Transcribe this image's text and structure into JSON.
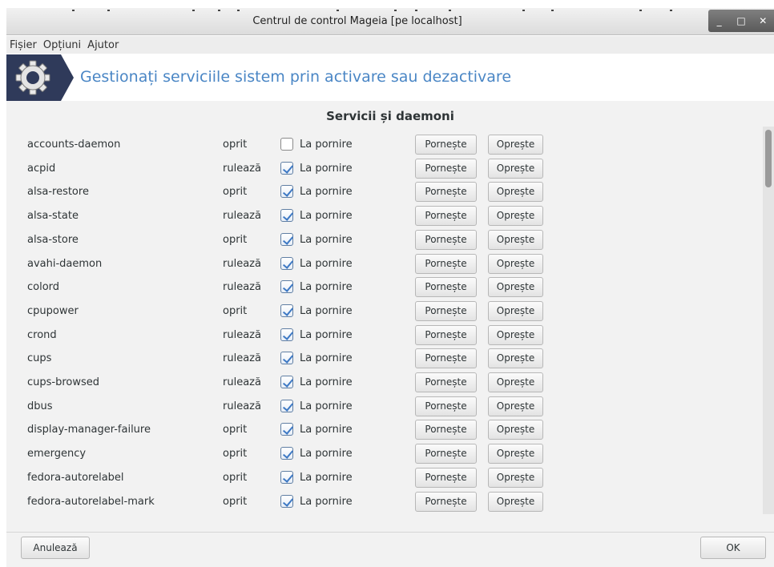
{
  "window": {
    "title": "Centrul de control Mageia  [pe localhost]",
    "controls": {
      "minimize": "_",
      "maximize": "□",
      "close": "✕"
    }
  },
  "menu": [
    "Fișier",
    "Opțiuni",
    "Ajutor"
  ],
  "banner": {
    "title": "Gestionați serviciile sistem prin activare sau dezactivare",
    "icon": "gear-icon"
  },
  "section_title": "Servicii și daemoni",
  "services": [
    {
      "name": "accounts-daemon",
      "state": "oprit",
      "on_boot": false,
      "boot_label": "La pornire",
      "start": "Pornește",
      "stop": "Oprește"
    },
    {
      "name": "acpid",
      "state": "rulează",
      "on_boot": true,
      "boot_label": "La pornire",
      "start": "Pornește",
      "stop": "Oprește"
    },
    {
      "name": "alsa-restore",
      "state": "oprit",
      "on_boot": true,
      "boot_label": "La pornire",
      "start": "Pornește",
      "stop": "Oprește"
    },
    {
      "name": "alsa-state",
      "state": "rulează",
      "on_boot": true,
      "boot_label": "La pornire",
      "start": "Pornește",
      "stop": "Oprește"
    },
    {
      "name": "alsa-store",
      "state": "oprit",
      "on_boot": true,
      "boot_label": "La pornire",
      "start": "Pornește",
      "stop": "Oprește"
    },
    {
      "name": "avahi-daemon",
      "state": "rulează",
      "on_boot": true,
      "boot_label": "La pornire",
      "start": "Pornește",
      "stop": "Oprește"
    },
    {
      "name": "colord",
      "state": "rulează",
      "on_boot": true,
      "boot_label": "La pornire",
      "start": "Pornește",
      "stop": "Oprește"
    },
    {
      "name": "cpupower",
      "state": "oprit",
      "on_boot": true,
      "boot_label": "La pornire",
      "start": "Pornește",
      "stop": "Oprește"
    },
    {
      "name": "crond",
      "state": "rulează",
      "on_boot": true,
      "boot_label": "La pornire",
      "start": "Pornește",
      "stop": "Oprește"
    },
    {
      "name": "cups",
      "state": "rulează",
      "on_boot": true,
      "boot_label": "La pornire",
      "start": "Pornește",
      "stop": "Oprește"
    },
    {
      "name": "cups-browsed",
      "state": "rulează",
      "on_boot": true,
      "boot_label": "La pornire",
      "start": "Pornește",
      "stop": "Oprește"
    },
    {
      "name": "dbus",
      "state": "rulează",
      "on_boot": true,
      "boot_label": "La pornire",
      "start": "Pornește",
      "stop": "Oprește"
    },
    {
      "name": "display-manager-failure",
      "state": "oprit",
      "on_boot": true,
      "boot_label": "La pornire",
      "start": "Pornește",
      "stop": "Oprește"
    },
    {
      "name": "emergency",
      "state": "oprit",
      "on_boot": true,
      "boot_label": "La pornire",
      "start": "Pornește",
      "stop": "Oprește"
    },
    {
      "name": "fedora-autorelabel",
      "state": "oprit",
      "on_boot": true,
      "boot_label": "La pornire",
      "start": "Pornește",
      "stop": "Oprește"
    },
    {
      "name": "fedora-autorelabel-mark",
      "state": "oprit",
      "on_boot": true,
      "boot_label": "La pornire",
      "start": "Pornește",
      "stop": "Oprește"
    }
  ],
  "footer": {
    "cancel": "Anulează",
    "ok": "OK"
  },
  "colors": {
    "banner_text": "#4a86c5",
    "icon_bg": "#2f3a5a",
    "checkmark": "#3e79c4"
  }
}
